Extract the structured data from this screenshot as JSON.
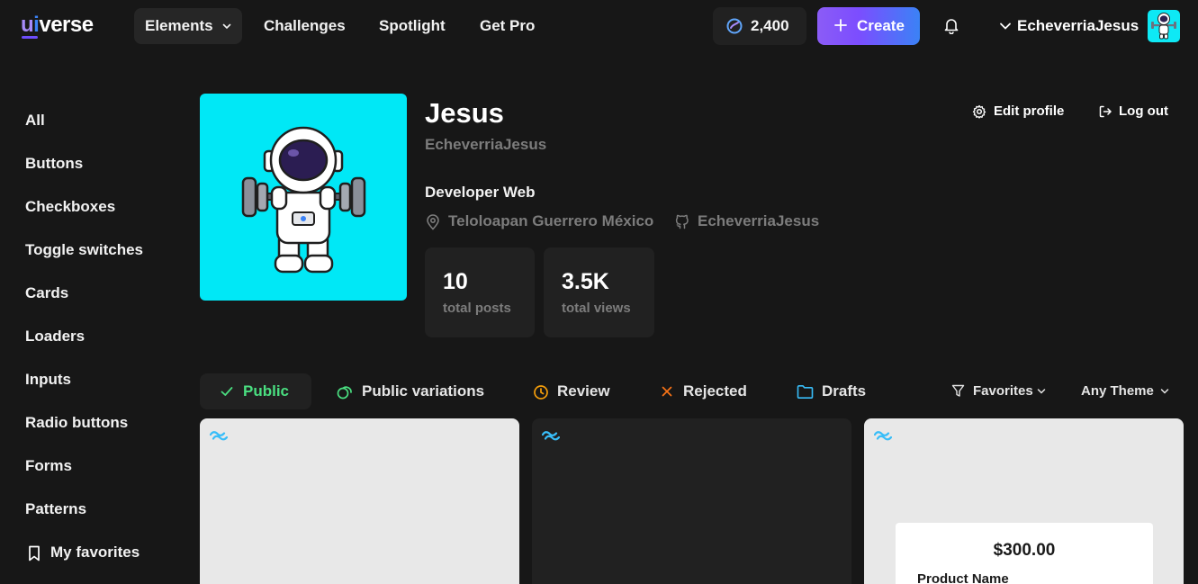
{
  "brand": {
    "logo_u": "u",
    "logo_i": "i",
    "logo_rest": "verse"
  },
  "nav": {
    "elements": "Elements",
    "challenges": "Challenges",
    "spotlight": "Spotlight",
    "get_pro": "Get Pro",
    "points": "2,400",
    "create": "Create",
    "username": "EcheverriaJesus"
  },
  "sidebar": {
    "items": [
      "All",
      "Buttons",
      "Checkboxes",
      "Toggle switches",
      "Cards",
      "Loaders",
      "Inputs",
      "Radio buttons",
      "Forms",
      "Patterns"
    ],
    "favorites": "My favorites"
  },
  "profile": {
    "name": "Jesus",
    "handle": "EcheverriaJesus",
    "role": "Developer Web",
    "location": "Teloloapan Guerrero México",
    "github": "EcheverriaJesus",
    "edit_profile": "Edit profile",
    "logout": "Log out",
    "stats": {
      "posts_value": "10",
      "posts_label": "total posts",
      "views_value": "3.5K",
      "views_label": "total views"
    }
  },
  "tabs": {
    "public": "Public",
    "variations": "Public variations",
    "review": "Review",
    "rejected": "Rejected",
    "drafts": "Drafts"
  },
  "filters": {
    "favorites": "Favorites",
    "theme": "Any Theme"
  },
  "cards": {
    "product_price": "$300.00",
    "product_name": "Product Name"
  },
  "colors": {
    "background": "#171717",
    "surface": "#212121",
    "accent_purple": "#8b5cf6",
    "accent_blue": "#3b82f6",
    "public_green": "#4ade80",
    "review_amber": "#f59e0b",
    "rejected_orange": "#f97316",
    "drafts_blue": "#38bdf8",
    "avatar_cyan": "#00e8f6"
  },
  "icons": [
    "coin-icon",
    "plus-icon",
    "bell-icon",
    "chevron-down-icon",
    "bookmark-icon",
    "map-pin-icon",
    "github-icon",
    "gear-icon",
    "logout-icon",
    "check-icon",
    "variations-icon",
    "clock-icon",
    "x-icon",
    "folder-icon",
    "filter-icon",
    "tailwind-icon"
  ]
}
